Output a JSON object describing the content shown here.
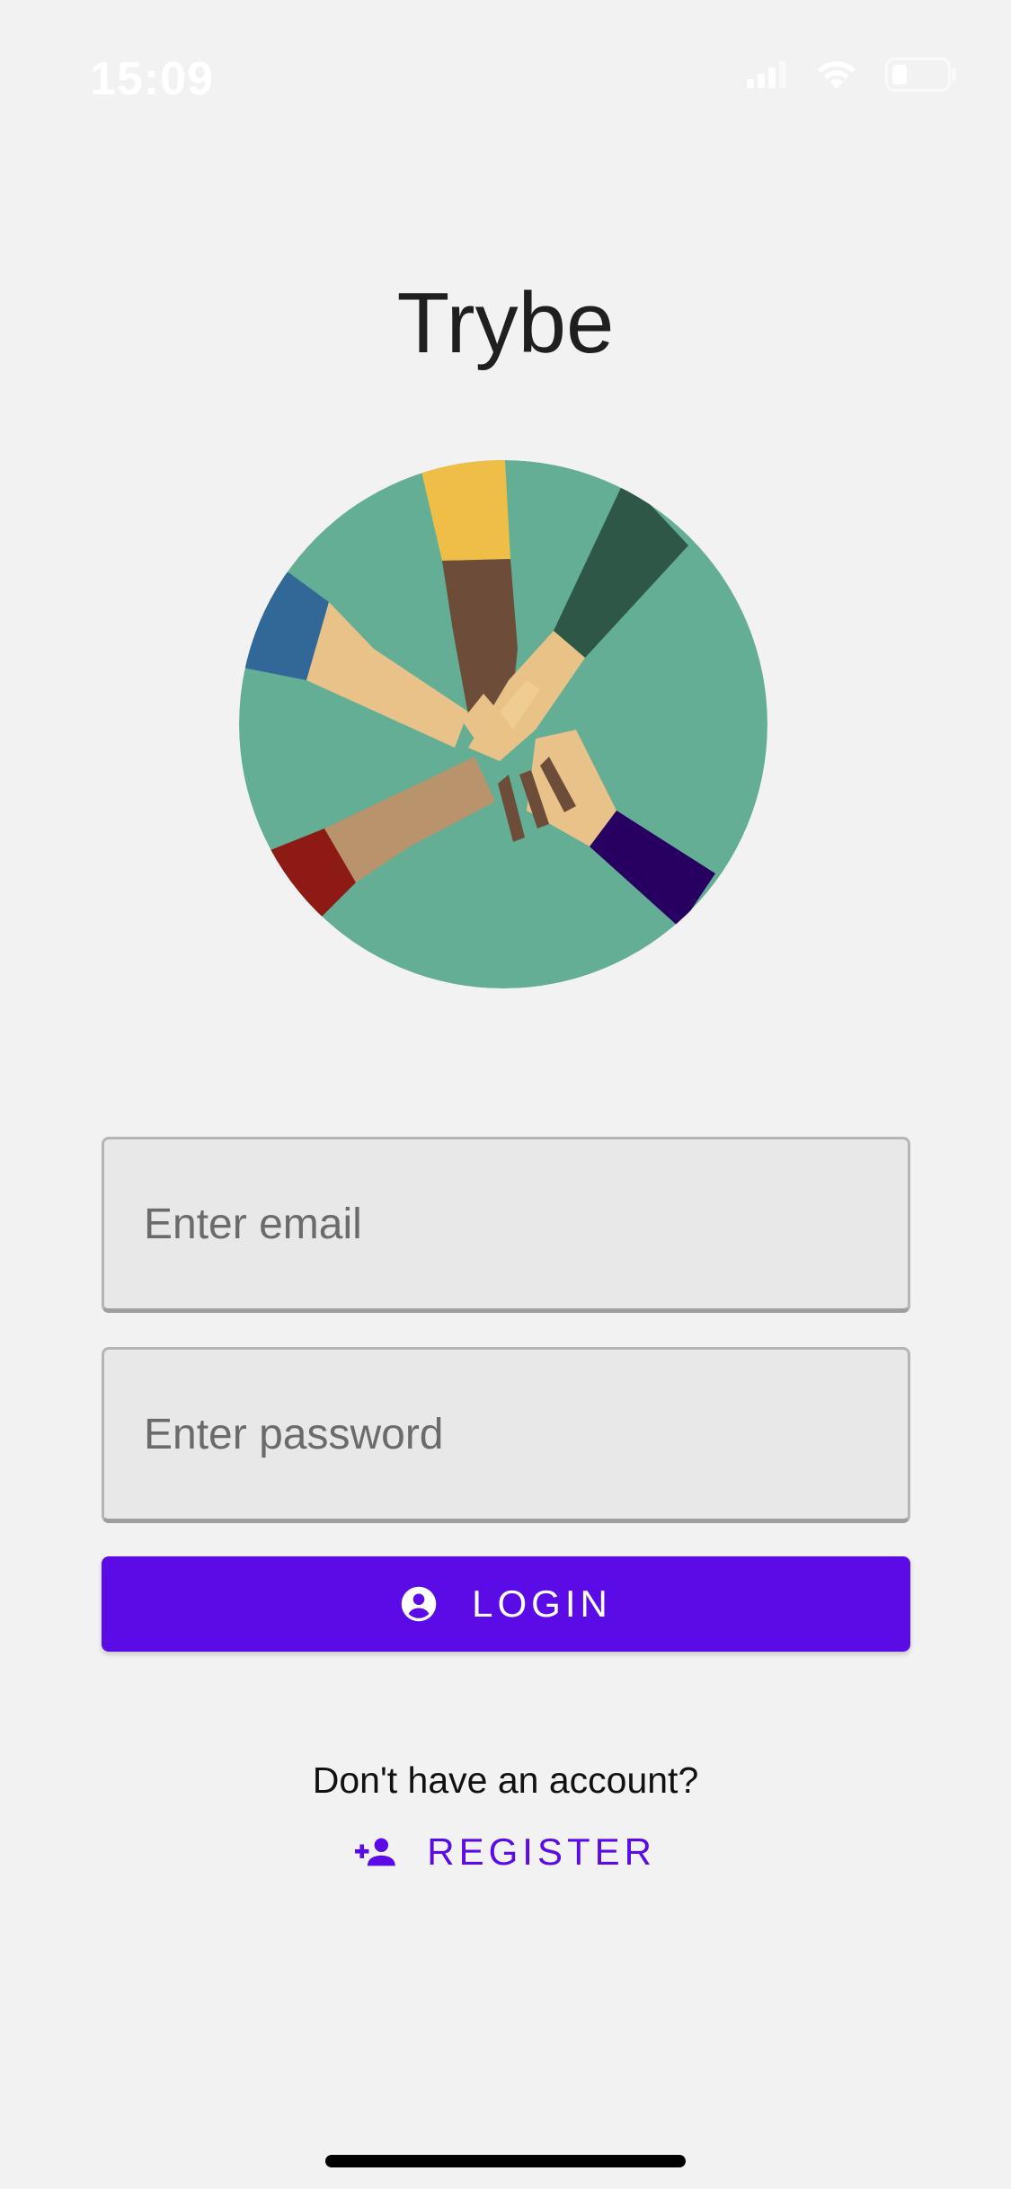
{
  "status_bar": {
    "time": "15:09",
    "icons": [
      "signal-icon",
      "wifi-icon",
      "battery-icon"
    ]
  },
  "app": {
    "title": "Trybe"
  },
  "hero_image": {
    "description_icon": "team-hands-illustration"
  },
  "form": {
    "email_placeholder": "Enter email",
    "email_value": "",
    "password_placeholder": "Enter password",
    "password_value": "",
    "login_label": "LOGIN",
    "login_icon": "account-circle-icon"
  },
  "register": {
    "prompt": "Don't have an account?",
    "label": "REGISTER",
    "icon": "person-add-icon"
  },
  "colors": {
    "background": "#f2f2f2",
    "accent": "#5b0ce6",
    "field_bg": "#e8e8e8",
    "hero_circle": "#63ae94"
  }
}
